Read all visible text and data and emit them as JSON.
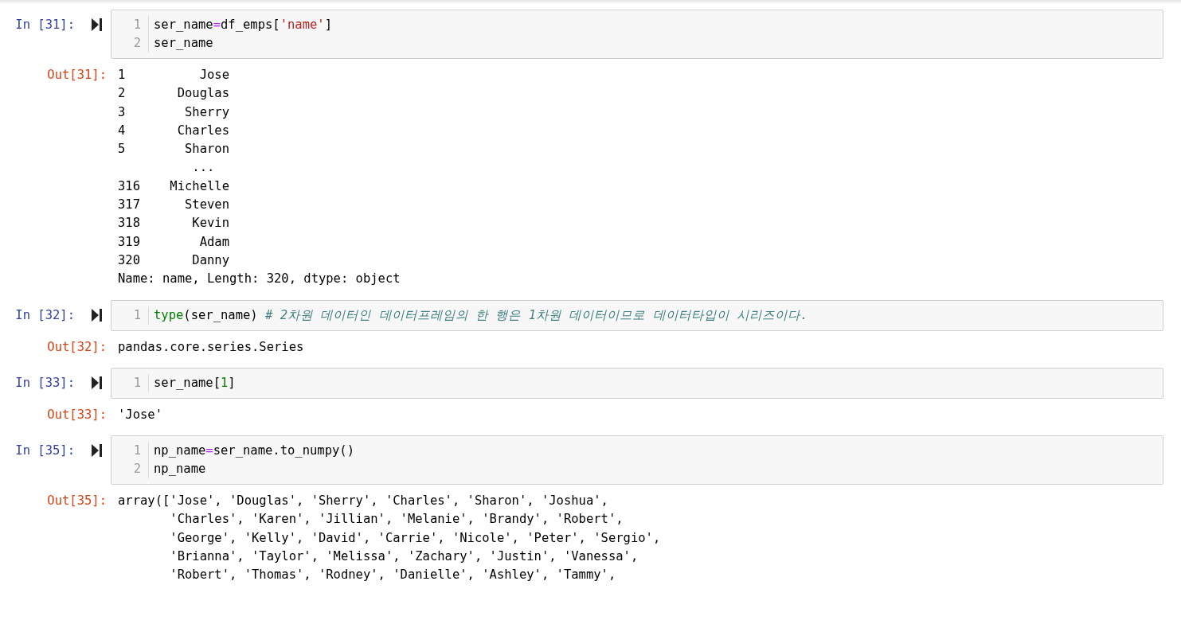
{
  "cells": [
    {
      "prompt": "In [31]:",
      "lines": [
        {
          "number": "1",
          "tokens": [
            {
              "kind": "name",
              "text": "ser_name"
            },
            {
              "kind": "operator",
              "text": "="
            },
            {
              "kind": "name",
              "text": "df_emps["
            },
            {
              "kind": "string",
              "text": "'name'"
            },
            {
              "kind": "name",
              "text": "]"
            }
          ]
        },
        {
          "number": "2",
          "tokens": [
            {
              "kind": "name",
              "text": "ser_name"
            }
          ]
        }
      ],
      "out_prompt": "Out[31]:",
      "output": [
        "1          Jose",
        "2       Douglas",
        "3        Sherry",
        "4       Charles",
        "5        Sharon",
        "          ...",
        "316    Michelle",
        "317      Steven",
        "318       Kevin",
        "319        Adam",
        "320       Danny",
        "Name: name, Length: 320, dtype: object"
      ]
    },
    {
      "prompt": "In [32]:",
      "lines": [
        {
          "number": "1",
          "tokens": [
            {
              "kind": "builtin",
              "text": "type"
            },
            {
              "kind": "name",
              "text": "(ser_name) "
            },
            {
              "kind": "comment",
              "text": "# 2차원 데이터인 데이터프레임의 한 행은 1차원 데이터이므로 데이터타입이 시리즈이다."
            }
          ]
        }
      ],
      "out_prompt": "Out[32]:",
      "output": [
        "pandas.core.series.Series"
      ]
    },
    {
      "prompt": "In [33]:",
      "lines": [
        {
          "number": "1",
          "tokens": [
            {
              "kind": "name",
              "text": "ser_name["
            },
            {
              "kind": "number",
              "text": "1"
            },
            {
              "kind": "name",
              "text": "]"
            }
          ]
        }
      ],
      "out_prompt": "Out[33]:",
      "output": [
        "'Jose'"
      ]
    },
    {
      "prompt": "In [35]:",
      "lines": [
        {
          "number": "1",
          "tokens": [
            {
              "kind": "name",
              "text": "np_name"
            },
            {
              "kind": "operator",
              "text": "="
            },
            {
              "kind": "name",
              "text": "ser_name.to_numpy()"
            }
          ]
        },
        {
          "number": "2",
          "tokens": [
            {
              "kind": "name",
              "text": "np_name"
            }
          ]
        }
      ],
      "out_prompt": "Out[35]:",
      "output": [
        "array(['Jose', 'Douglas', 'Sherry', 'Charles', 'Sharon', 'Joshua',",
        "       'Charles', 'Karen', 'Jillian', 'Melanie', 'Brandy', 'Robert',",
        "       'George', 'Kelly', 'David', 'Carrie', 'Nicole', 'Peter', 'Sergio',",
        "       'Brianna', 'Taylor', 'Melissa', 'Zachary', 'Justin', 'Vanessa',",
        "       'Robert', 'Thomas', 'Rodney', 'Danielle', 'Ashley', 'Tammy',"
      ]
    }
  ]
}
